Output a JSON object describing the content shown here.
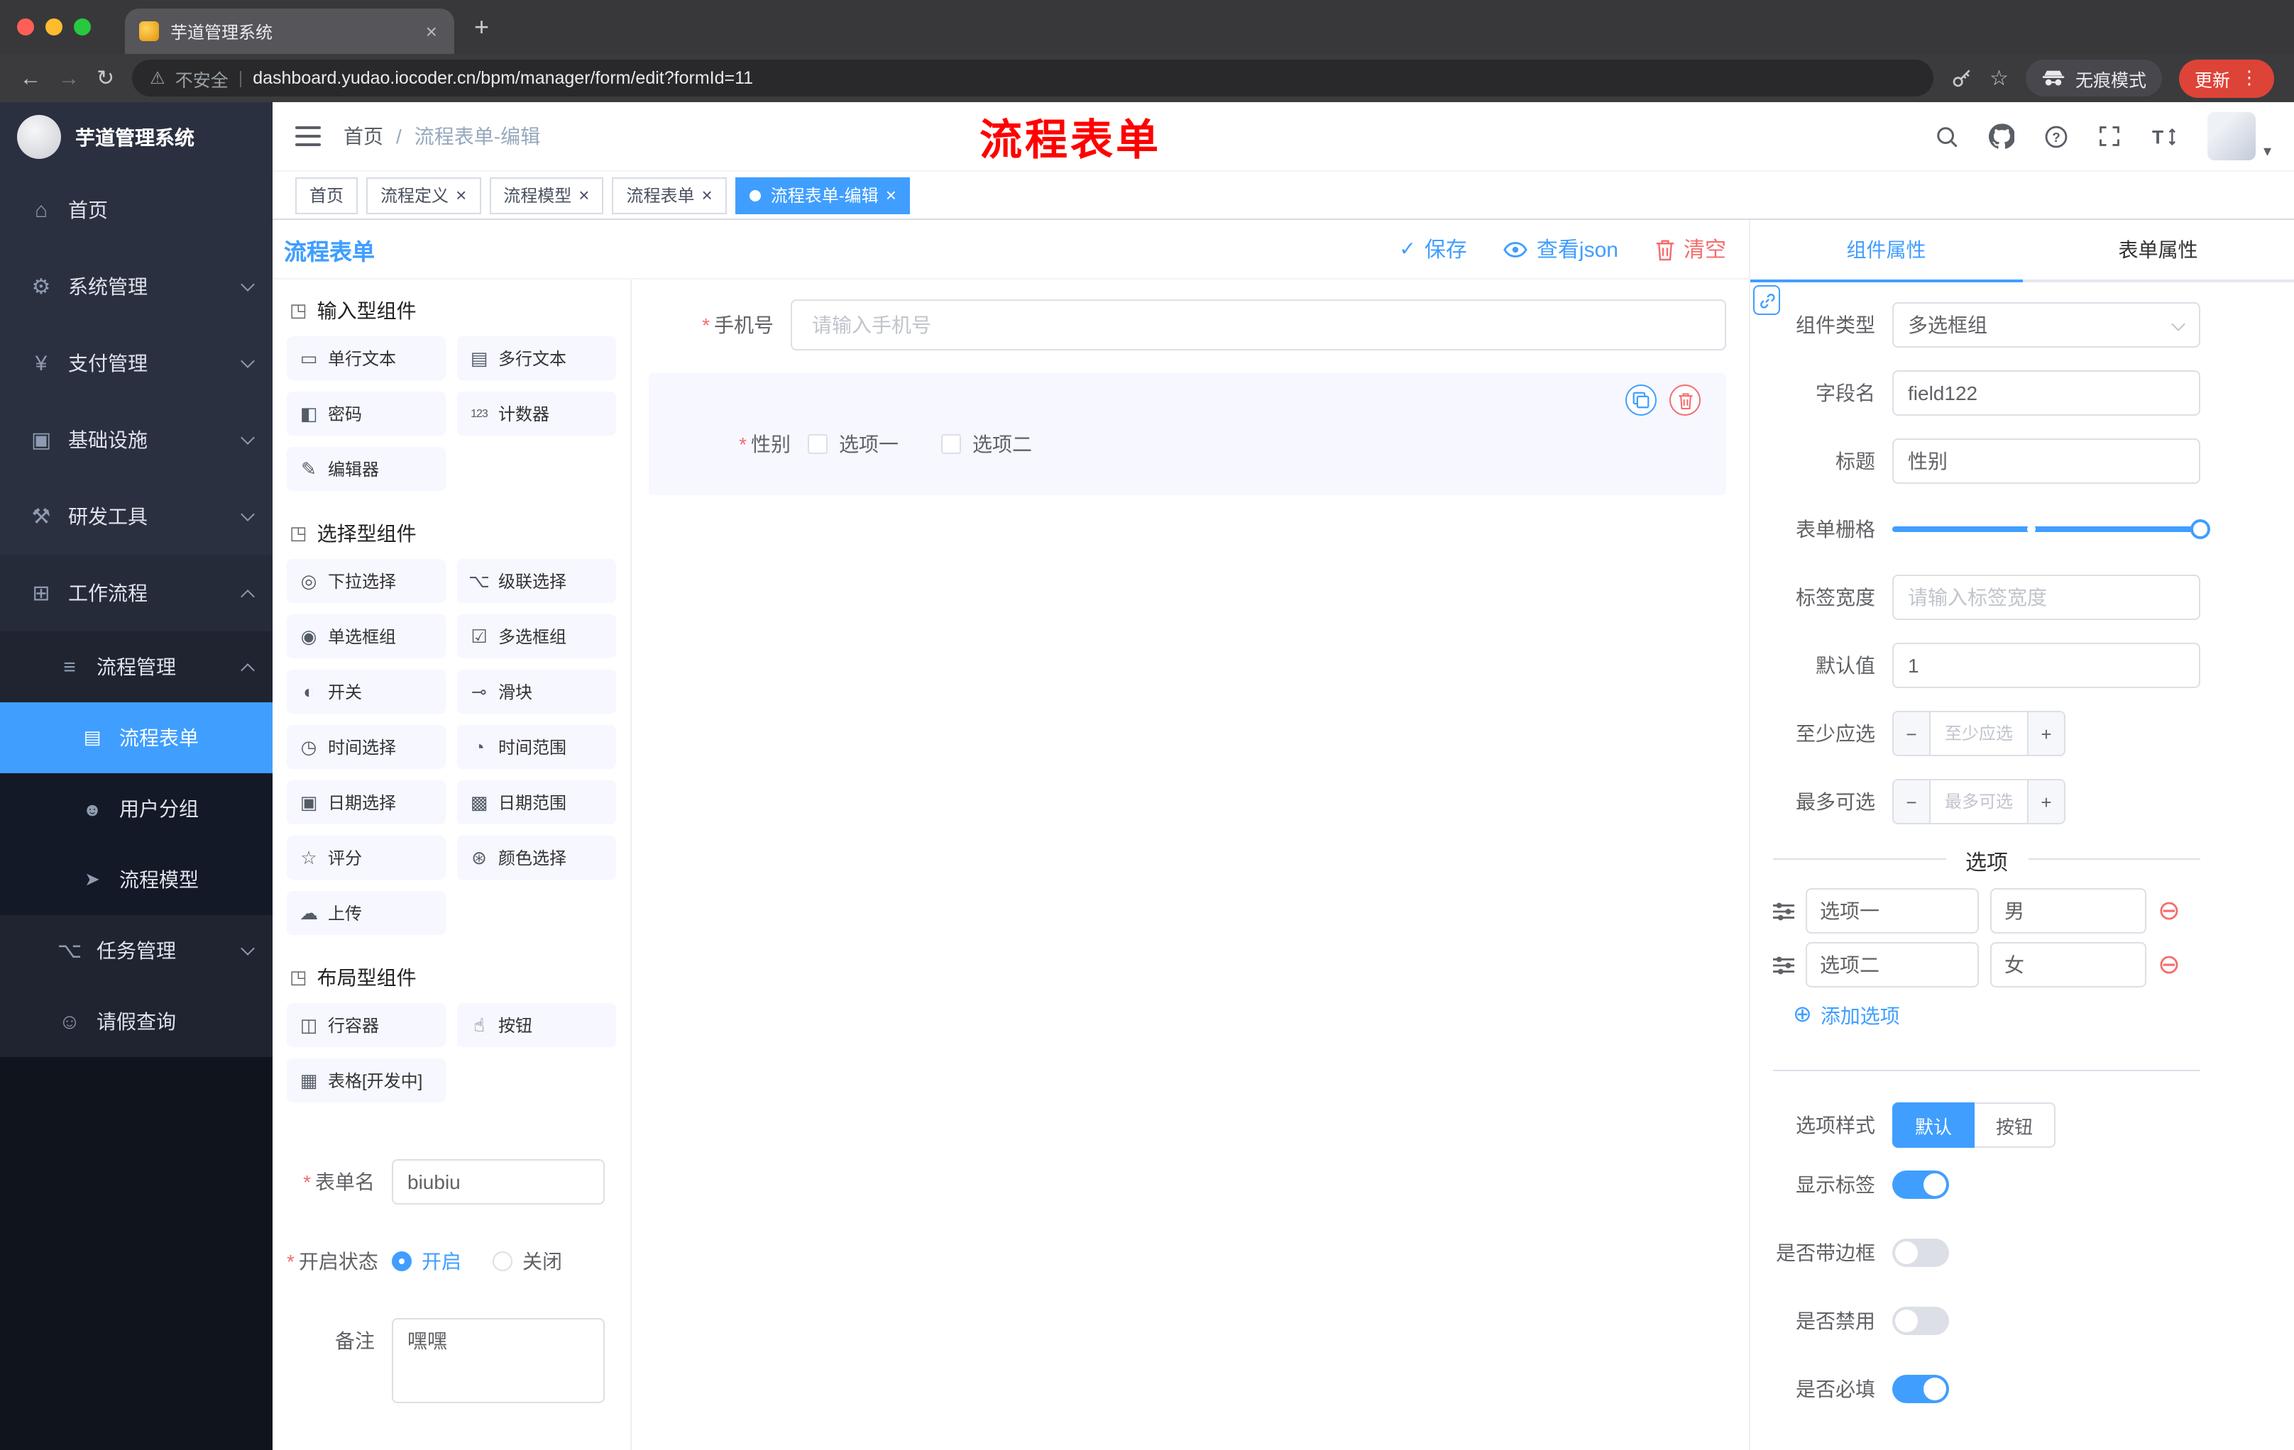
{
  "browser": {
    "tab_title": "芋道管理系统",
    "new_tab": "+",
    "security_label": "不安全",
    "url": "dashboard.yudao.iocoder.cn/bpm/manager/form/edit?formId=11",
    "incognito_label": "无痕模式",
    "update_label": "更新"
  },
  "sidebar": {
    "logo_title": "芋道管理系统",
    "menu": [
      {
        "label": "首页",
        "icon": "⌂"
      },
      {
        "label": "系统管理",
        "icon": "⚙"
      },
      {
        "label": "支付管理",
        "icon": "¥"
      },
      {
        "label": "基础设施",
        "icon": "▣"
      },
      {
        "label": "研发工具",
        "icon": "⚒"
      },
      {
        "label": "工作流程",
        "icon": "⊞"
      }
    ],
    "submenu": {
      "process_mgmt": {
        "label": "流程管理",
        "icon": "≡"
      },
      "children": [
        {
          "label": "流程表单",
          "icon": "▤"
        },
        {
          "label": "用户分组",
          "icon": "☻"
        },
        {
          "label": "流程模型",
          "icon": "➤"
        }
      ],
      "task_mgmt": {
        "label": "任务管理",
        "icon": "⌥"
      },
      "leave_query": {
        "label": "请假查询",
        "icon": "☺"
      }
    }
  },
  "header": {
    "breadcrumb_home": "首页",
    "breadcrumb_sep": "/",
    "breadcrumb_current": "流程表单-编辑",
    "watermark": "流程表单"
  },
  "tags": [
    {
      "label": "首页"
    },
    {
      "label": "流程定义"
    },
    {
      "label": "流程模型"
    },
    {
      "label": "流程表单"
    },
    {
      "label": "流程表单-编辑"
    }
  ],
  "designer": {
    "panel_title": "流程表单",
    "actions": {
      "save": "保存",
      "view_json": "查看json",
      "clear": "清空"
    }
  },
  "palette": {
    "groups": [
      {
        "title": "输入型组件",
        "items": [
          {
            "label": "单行文本",
            "icon": "▭"
          },
          {
            "label": "多行文本",
            "icon": "▤"
          },
          {
            "label": "密码",
            "icon": "◧"
          },
          {
            "label": "计数器",
            "icon": "123"
          },
          {
            "label": "编辑器",
            "icon": "✎"
          }
        ]
      },
      {
        "title": "选择型组件",
        "items": [
          {
            "label": "下拉选择",
            "icon": "◎"
          },
          {
            "label": "级联选择",
            "icon": "⌥"
          },
          {
            "label": "单选框组",
            "icon": "◉"
          },
          {
            "label": "多选框组",
            "icon": "☑"
          },
          {
            "label": "开关",
            "icon": "◐"
          },
          {
            "label": "滑块",
            "icon": "⊸"
          },
          {
            "label": "时间选择",
            "icon": "◷"
          },
          {
            "label": "时间范围",
            "icon": "◔"
          },
          {
            "label": "日期选择",
            "icon": "▣"
          },
          {
            "label": "日期范围",
            "icon": "▩"
          },
          {
            "label": "评分",
            "icon": "☆"
          },
          {
            "label": "颜色选择",
            "icon": "⊛"
          },
          {
            "label": "上传",
            "icon": "☁"
          }
        ]
      },
      {
        "title": "布局型组件",
        "items": [
          {
            "label": "行容器",
            "icon": "◫"
          },
          {
            "label": "按钮",
            "icon": "☝"
          },
          {
            "label": "表格[开发中]",
            "icon": "▦"
          }
        ]
      }
    ],
    "form": {
      "name_label": "表单名",
      "name_value": "biubiu",
      "status_label": "开启状态",
      "status_on": "开启",
      "status_off": "关闭",
      "remark_label": "备注",
      "remark_value": "嘿嘿"
    }
  },
  "canvas": {
    "phone_label": "手机号",
    "phone_placeholder": "请输入手机号",
    "gender_label": "性别",
    "gender_options": [
      {
        "label": "选项一"
      },
      {
        "label": "选项二"
      }
    ]
  },
  "props": {
    "tab_component": "组件属性",
    "tab_form": "表单属性",
    "component_type_label": "组件类型",
    "component_type_value": "多选框组",
    "field_name_label": "字段名",
    "field_name_value": "field122",
    "title_label": "标题",
    "title_value": "性别",
    "grid_label": "表单栅格",
    "label_width_label": "标签宽度",
    "label_width_placeholder": "请输入标签宽度",
    "default_label": "默认值",
    "default_value": "1",
    "min_label": "至少应选",
    "min_placeholder": "至少应选",
    "max_label": "最多可选",
    "max_placeholder": "最多可选",
    "options_title": "选项",
    "options": [
      {
        "name": "选项一",
        "value": "男"
      },
      {
        "name": "选项二",
        "value": "女"
      }
    ],
    "add_option": "添加选项",
    "option_style_label": "选项样式",
    "style_default": "默认",
    "style_button": "按钮",
    "switches": [
      {
        "label": "显示标签",
        "on": true
      },
      {
        "label": "是否带边框",
        "on": false
      },
      {
        "label": "是否禁用",
        "on": false
      },
      {
        "label": "是否必填",
        "on": true
      }
    ]
  },
  "colors": {
    "primary": "#409EFF",
    "danger": "#F56C6C",
    "watermark": "#FF0000"
  }
}
